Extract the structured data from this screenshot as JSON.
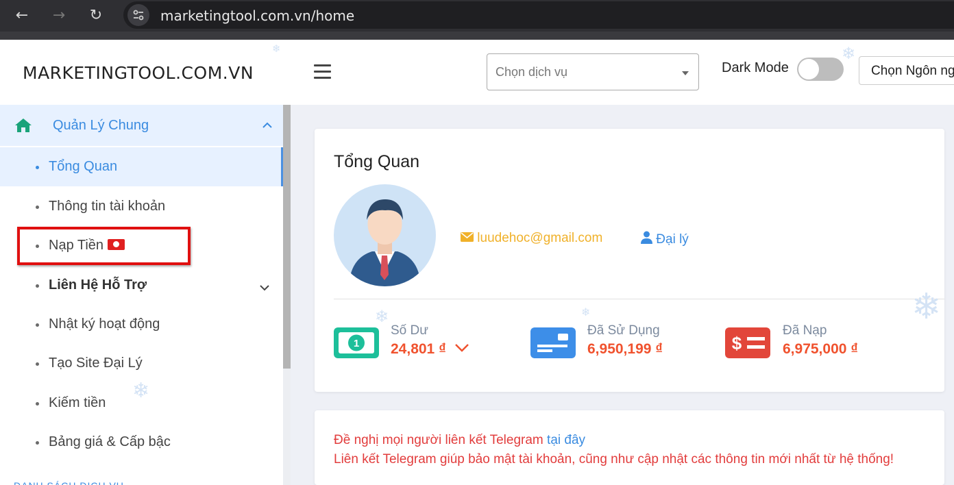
{
  "browser": {
    "url": "marketingtool.com.vn/home",
    "back_glyph": "←",
    "forward_glyph": "→",
    "reload_glyph": "↻"
  },
  "header": {
    "brand": "MARKETINGTOOL.COM.VN",
    "service_placeholder": "Chọn dịch vụ",
    "dark_mode_label": "Dark Mode",
    "dark_mode_on": false,
    "language_button": "Chọn Ngôn ngữ"
  },
  "sidebar": {
    "group_label": "Quản Lý Chung",
    "items": [
      {
        "label": "Tổng Quan",
        "active": true
      },
      {
        "label": "Thông tin tài khoản"
      },
      {
        "label": "Nạp Tiền"
      },
      {
        "label": "Liên Hệ Hỗ Trợ"
      },
      {
        "label": "Nhật ký hoạt động"
      },
      {
        "label": "Tạo Site Đại Lý"
      },
      {
        "label": "Kiếm tiền"
      },
      {
        "label": "Bảng giá & Cấp bậc"
      }
    ],
    "next_section": "DANH SÁCH DỊCH VỤ"
  },
  "overview": {
    "title": "Tổng Quan",
    "email": "luudehoc@gmail.com",
    "role": "Đại lý",
    "stats": [
      {
        "label": "Số Dư",
        "value": "24,801 ₫",
        "icon": "banknote-icon",
        "color": "#1dbf9a"
      },
      {
        "label": "Đã Sử Dụng",
        "value": "6,950,199 ₫",
        "icon": "card-icon",
        "color": "#3d8ee8"
      },
      {
        "label": "Đã Nạp",
        "value": "6,975,000 ₫",
        "icon": "dollar-list-icon",
        "color": "#e2463a"
      }
    ]
  },
  "notice": {
    "line1_prefix": "Đề nghị mọi người liên kết Telegram ",
    "line1_link": "tại đây",
    "line2": "Liên kết Telegram giúp bảo mật tài khoản, cũng như cập nhật các thông tin mới nhất từ hệ thống!"
  },
  "colors": {
    "accent": "#3a8be0",
    "highlight": "#e01010",
    "amount": "#f0522e"
  }
}
